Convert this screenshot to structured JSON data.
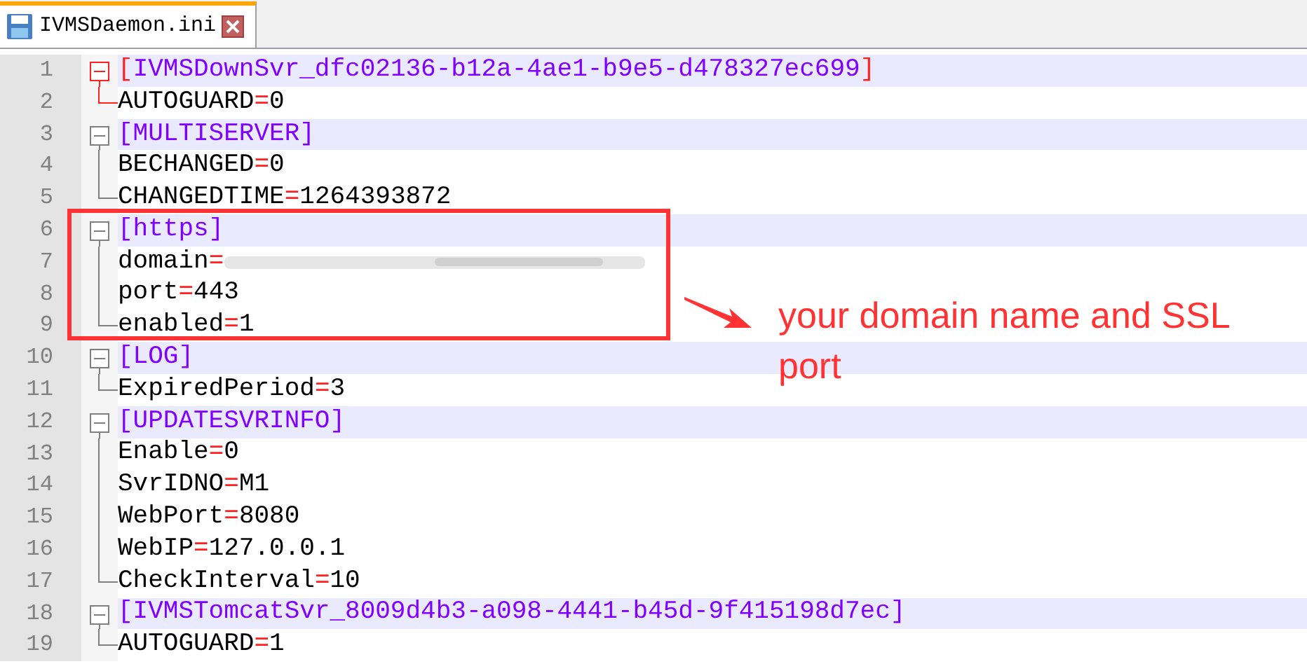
{
  "tab": {
    "title": "IVMSDaemon.ini",
    "selected": true
  },
  "sections": [
    {
      "number": "1",
      "header": "[IVMSDownSvr_dfc02136-b12a-4ae1-b9e5-d478327ec699]",
      "active": true,
      "lines": [
        {
          "number": "2",
          "key": "AUTOGUARD",
          "separator": "=",
          "value": "0"
        }
      ]
    },
    {
      "number": "3",
      "header": "[MULTISERVER]",
      "active": false,
      "lines": [
        {
          "number": "4",
          "key": "BECHANGED",
          "separator": "=",
          "value": "0"
        },
        {
          "number": "5",
          "key": "CHANGEDTIME",
          "separator": "=",
          "value": "1264393872"
        }
      ]
    },
    {
      "number": "6",
      "header": "[https]",
      "active": false,
      "lines": [
        {
          "number": "7",
          "key": "domain",
          "separator": "=",
          "redacted": true
        },
        {
          "number": "8",
          "key": "port",
          "separator": "=",
          "value": "443"
        },
        {
          "number": "9",
          "key": "enabled",
          "separator": "=",
          "value": "1"
        }
      ]
    },
    {
      "number": "10",
      "header": "[LOG]",
      "active": false,
      "lines": [
        {
          "number": "11",
          "key": "ExpiredPeriod",
          "separator": "=",
          "value": "3"
        }
      ]
    },
    {
      "number": "12",
      "header": "[UPDATESVRINFO]",
      "active": false,
      "lines": [
        {
          "number": "13",
          "key": "Enable",
          "separator": "=",
          "value": "0"
        },
        {
          "number": "14",
          "key": "SvrIDNO",
          "separator": "=",
          "value": "M1"
        },
        {
          "number": "15",
          "key": "WebPort",
          "separator": "=",
          "value": "8080"
        },
        {
          "number": "16",
          "key": "WebIP",
          "separator": "=",
          "value": "127.0.0.1"
        },
        {
          "number": "17",
          "key": "CheckInterval",
          "separator": "=",
          "value": "10"
        }
      ]
    },
    {
      "number": "18",
      "header": "[IVMSTomcatSvr_8009d4b3-a098-4441-b45d-9f415198d7ec]",
      "active": false,
      "lines": [
        {
          "number": "19",
          "key": "AUTOGUARD",
          "separator": "=",
          "value": "1"
        }
      ]
    }
  ],
  "annotation": {
    "text": "your domain name and SSL port"
  }
}
